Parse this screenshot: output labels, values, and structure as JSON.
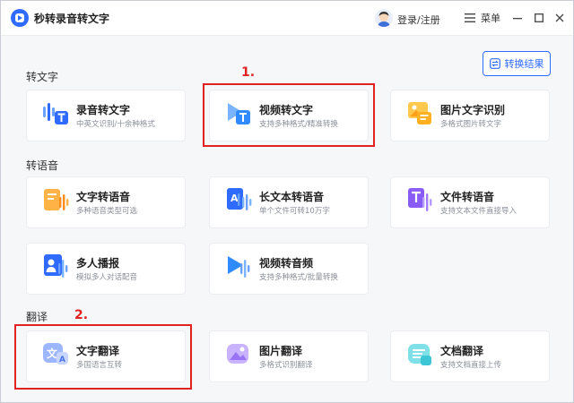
{
  "app": {
    "title": "秒转录音转文字"
  },
  "header": {
    "login_label": "登录/注册",
    "menu_label": "菜单"
  },
  "toolbar": {
    "result_label": "转换结果"
  },
  "sections": {
    "to_text": "转文字",
    "to_speech": "转语音",
    "translate": "翻译"
  },
  "cards": {
    "audio_to_text": {
      "title": "录音转文字",
      "subtitle": "中英文识别/十余种格式",
      "icon": "audio-waveform-icon"
    },
    "video_to_text": {
      "title": "视频转文字",
      "subtitle": "支持多种格式/精准转换",
      "icon": "video-text-icon"
    },
    "image_ocr": {
      "title": "图片文字识别",
      "subtitle": "多格式图片转文字",
      "icon": "image-text-icon"
    },
    "text_to_speech": {
      "title": "文字转语音",
      "subtitle": "多种语音类型可选",
      "icon": "text-speech-icon"
    },
    "long_text_speech": {
      "title": "长文本转语音",
      "subtitle": "单个文件可转10万字",
      "icon": "long-text-speech-icon"
    },
    "file_to_speech": {
      "title": "文件转语音",
      "subtitle": "支持文本文件直接导入",
      "icon": "file-speech-icon"
    },
    "multi_voice": {
      "title": "多人播报",
      "subtitle": "模拟多人对话配音",
      "icon": "multi-voice-icon"
    },
    "video_to_audio": {
      "title": "视频转音频",
      "subtitle": "支持多种格式/批量转换",
      "icon": "video-audio-icon"
    },
    "text_translate": {
      "title": "文字翻译",
      "subtitle": "多国语言互转",
      "icon": "text-translate-icon"
    },
    "image_translate": {
      "title": "图片翻译",
      "subtitle": "多格式识别翻译",
      "icon": "image-translate-icon"
    },
    "doc_translate": {
      "title": "文档翻译",
      "subtitle": "支持文档直接上传",
      "icon": "doc-translate-icon"
    }
  },
  "annotations": {
    "mark1": "1.",
    "mark2": "2."
  },
  "colors": {
    "accent": "#2f6bff",
    "highlight": "#e02222"
  }
}
